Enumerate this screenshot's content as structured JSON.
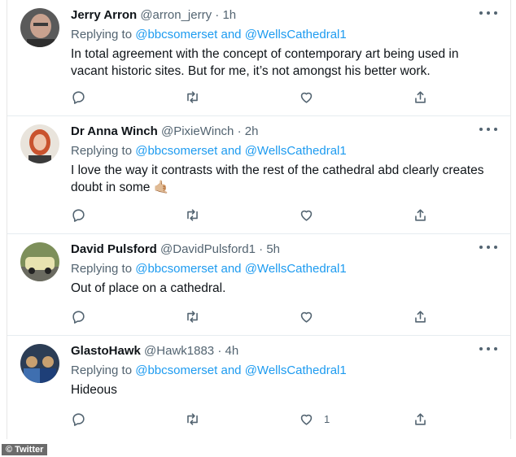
{
  "tweets": [
    {
      "name": "Jerry Arron",
      "handle": "@arron_jerry",
      "separator": "·",
      "time": "1h",
      "replying_label": "Replying to",
      "reply_to_1": "@bbcsomerset",
      "reply_and": "and",
      "reply_to_2": "@WellsCathedral1",
      "text": "In total agreement with the concept of contemporary art being used in vacant historic sites. But for me, it’s not amongst his better work.",
      "like_count": ""
    },
    {
      "name": "Dr Anna Winch",
      "handle": "@PixieWinch",
      "separator": "·",
      "time": "2h",
      "replying_label": "Replying to",
      "reply_to_1": "@bbcsomerset",
      "reply_and": "and",
      "reply_to_2": "@WellsCathedral1",
      "text": "I love the way it contrasts with the rest of the cathedral abd clearly creates doubt in some 🤙🏼",
      "like_count": ""
    },
    {
      "name": "David Pulsford",
      "handle": "@DavidPulsford1",
      "separator": "·",
      "time": "5h",
      "replying_label": "Replying to",
      "reply_to_1": "@bbcsomerset",
      "reply_and": "and",
      "reply_to_2": "@WellsCathedral1",
      "text": "Out of place on a cathedral.",
      "like_count": ""
    },
    {
      "name": "GlastoHawk",
      "handle": "@Hawk1883",
      "separator": "·",
      "time": "4h",
      "replying_label": "Replying to",
      "reply_to_1": "@bbcsomerset",
      "reply_and": "and",
      "reply_to_2": "@WellsCathedral1",
      "text": "Hideous",
      "like_count": "1"
    }
  ],
  "icons": {
    "reply": "reply-icon",
    "retweet": "retweet-icon",
    "like": "heart-icon",
    "share": "share-icon",
    "more": "more-options-icon"
  },
  "colors": {
    "link": "#1d9bf0",
    "secondary_text": "#536471",
    "primary_text": "#0f1419",
    "divider": "#e6ecf0"
  },
  "credit": "© Twitter"
}
